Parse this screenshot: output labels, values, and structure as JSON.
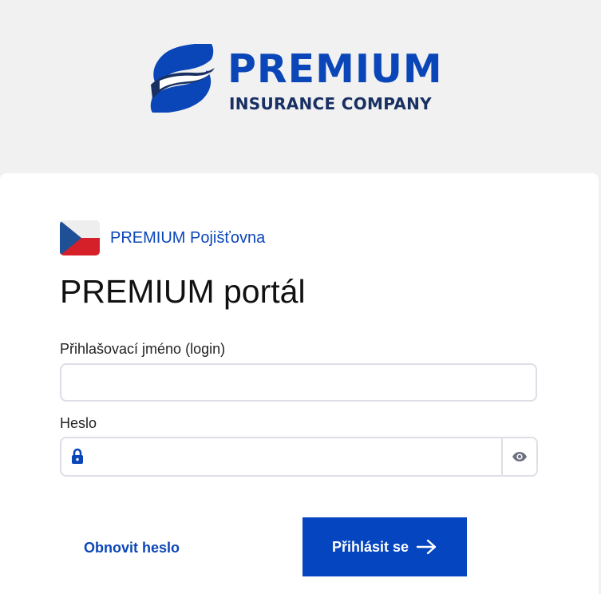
{
  "logo": {
    "word": "PREMIUM",
    "sub": "INSURANCE COMPANY",
    "primary_color": "#0b46b9",
    "secondary_color": "#183062",
    "icon": "premium-leaf-logo-icon"
  },
  "brand": {
    "country_icon": "czech-flag-icon",
    "name": "PREMIUM Pojišťovna"
  },
  "page": {
    "title": "PREMIUM portál"
  },
  "login": {
    "label": "Přihlašovací jméno (login)",
    "value": "",
    "placeholder": ""
  },
  "password": {
    "label": "Heslo",
    "value": "",
    "placeholder": "",
    "lock_icon": "lock-icon",
    "visibility_icon": "eye-icon"
  },
  "actions": {
    "forgot_password": "Obnovit heslo",
    "submit": "Přihlásit se",
    "submit_icon": "arrow-right-icon",
    "accent_color": "#0545bf"
  }
}
